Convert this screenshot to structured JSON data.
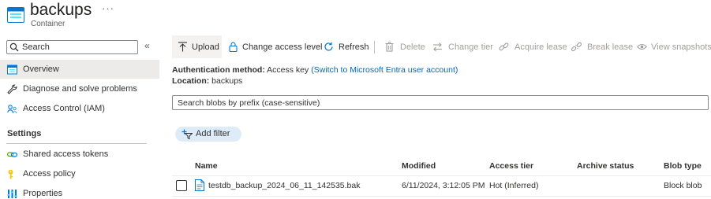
{
  "header": {
    "title": "backups",
    "more": "···",
    "subtitle": "Container"
  },
  "sidebar": {
    "search_placeholder": "Search",
    "collapse": "«",
    "items": [
      {
        "label": "Overview",
        "icon": "overview-icon",
        "selected": true
      },
      {
        "label": "Diagnose and solve problems",
        "icon": "wrench-icon"
      },
      {
        "label": "Access Control (IAM)",
        "icon": "iam-people-icon"
      }
    ],
    "settings_heading": "Settings",
    "settings_items": [
      {
        "label": "Shared access tokens",
        "icon": "link-icon"
      },
      {
        "label": "Access policy",
        "icon": "key-icon"
      },
      {
        "label": "Properties",
        "icon": "properties-bars-icon"
      }
    ]
  },
  "toolbar": {
    "upload": "Upload",
    "change_access_level": "Change access level",
    "refresh": "Refresh",
    "delete": "Delete",
    "change_tier": "Change tier",
    "acquire_lease": "Acquire lease",
    "break_lease": "Break lease",
    "view_snapshots": "View snapshots"
  },
  "info": {
    "auth_label": "Authentication method:",
    "auth_value": "Access key",
    "auth_link": "(Switch to Microsoft Entra user account)",
    "location_label": "Location:",
    "location_value": "backups"
  },
  "blob_search_placeholder": "Search blobs by prefix (case-sensitive)",
  "add_filter": "Add filter",
  "table": {
    "columns": [
      "Name",
      "Modified",
      "Access tier",
      "Archive status",
      "Blob type"
    ],
    "rows": [
      {
        "name": "testdb_backup_2024_06_11_142535.bak",
        "modified": "6/11/2024, 3:12:05 PM",
        "access_tier": "Hot (Inferred)",
        "archive_status": "",
        "blob_type": "Block blob"
      }
    ]
  },
  "colors": {
    "accent": "#0078d4",
    "link": "#0067b8",
    "disabled": "#a19f9d",
    "selected_bg": "#edebe9",
    "pill_bg": "#deecf9"
  }
}
